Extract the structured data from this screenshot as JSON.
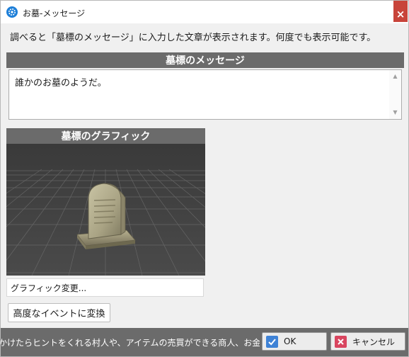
{
  "window": {
    "title": "お墓-メッセージ",
    "close_label": "×"
  },
  "description": "調べると「墓標のメッセージ」に入力した文章が表示されます。何度でも表示可能です。",
  "message_section": {
    "header": "墓標のメッセージ",
    "text": "誰かのお墓のようだ。"
  },
  "graphic_section": {
    "header": "墓標のグラフィック",
    "change_label": "グラフィック変更..."
  },
  "advanced_button": "高度なイベントに変換",
  "footer": {
    "tip": "かけたらヒントをくれる村人や、アイテムの売買ができる商人、お金が入",
    "ok_label": "OK",
    "cancel_label": "キャンセル"
  },
  "colors": {
    "header_bg": "#6b6b6b",
    "close_bg": "#c8443a",
    "ok_icon": "#3e82d6",
    "cancel_icon": "#d9455f"
  },
  "icons": {
    "app": "gear-icon",
    "close": "close-icon",
    "ok": "check-icon",
    "cancel": "x-icon"
  }
}
